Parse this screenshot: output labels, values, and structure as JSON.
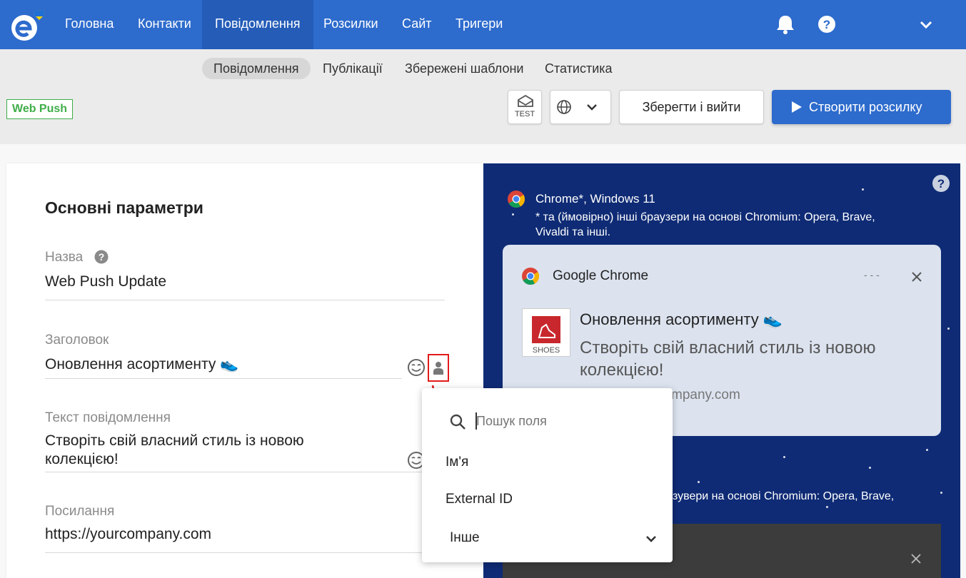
{
  "nav": {
    "items": [
      "Головна",
      "Контакти",
      "Повідомлення",
      "Розсилки",
      "Сайт",
      "Тригери"
    ],
    "active_index": 2,
    "icons": [
      "bell-icon",
      "help-icon",
      "chevron-down-icon"
    ]
  },
  "subnav": {
    "tabs": [
      "Повідомлення",
      "Публікації",
      "Збережені шаблони",
      "Статистика"
    ],
    "active_index": 0
  },
  "toolbar": {
    "channel_badge": "Web Push",
    "test_label": "TEST",
    "save_label": "Зберегти і вийти",
    "create_label": "Створити розсилку"
  },
  "form": {
    "section_title": "Основні параметри",
    "name_label": "Назва",
    "name_value": "Web Push Update",
    "title_label": "Заголовок",
    "title_value": "Оновлення асортименту 👟",
    "text_label": "Текст повідомлення",
    "text_value_line1": "Створіть свій власний стиль із новою",
    "text_value_line2": "колекцією!",
    "link_label": "Посилання",
    "link_value": "https://yourcompany.com"
  },
  "dropdown": {
    "search_placeholder": "Пошук поля",
    "items": [
      "Ім'я",
      "External ID"
    ],
    "group_label": "Інше"
  },
  "preview": {
    "browser_line": "Chrome*, Windows 11",
    "note_line1": "* та (ймовірно) інші браузери на основі Chromium: Opera, Brave,",
    "note_line2": "Vivaldi та інші.",
    "notification": {
      "app_name": "Google Chrome",
      "menu_dots": "- - -",
      "title": "Оновлення асортименту 👟",
      "body_line1": "Створіть свій власний стиль із новою",
      "body_line2": "колекцією!",
      "domain_visible": "mpany.com",
      "image_caption": "SHOES"
    },
    "lower_note_visible": "зувери на основі Chromium: Opera, Brave,"
  },
  "colors": {
    "brand_blue": "#2d6bcd",
    "preview_bg": "#0f2b75",
    "badge_green": "#3fae49",
    "highlight_red": "#e21b1b"
  }
}
